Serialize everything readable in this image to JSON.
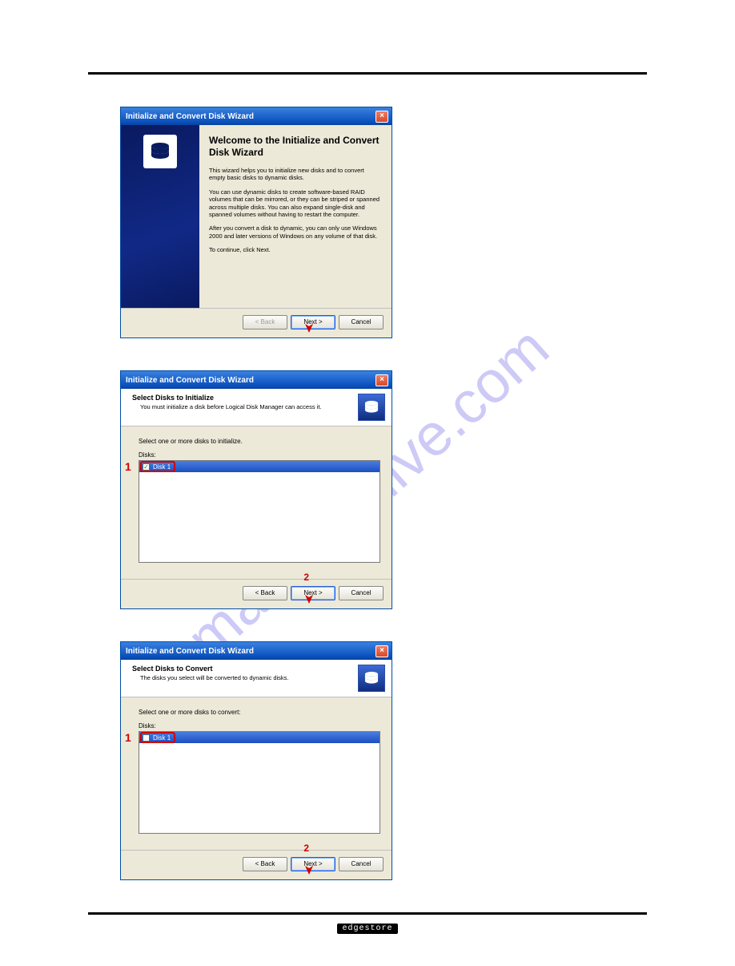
{
  "watermark": "manualshive.com",
  "footer_brand": "edgestore",
  "annotations": {
    "step1": "1",
    "step2": "2"
  },
  "dialog1": {
    "title": "Initialize and Convert Disk Wizard",
    "heading": "Welcome to the Initialize and Convert Disk Wizard",
    "p1": "This wizard helps you to initialize new disks and to convert empty basic disks to dynamic disks.",
    "p2": "You can use dynamic disks to create software-based RAID volumes that can be mirrored, or they can be striped or spanned across multiple disks. You can also expand single-disk and spanned volumes without having to restart the computer.",
    "p3": "After you convert a disk to dynamic, you can only use Windows 2000 and later versions of Windows on any volume of that disk.",
    "p4": "To continue, click Next.",
    "back": "< Back",
    "next": "Next >",
    "cancel": "Cancel"
  },
  "dialog2": {
    "title": "Initialize and Convert Disk Wizard",
    "step_title": "Select Disks to Initialize",
    "step_sub": "You must initialize a disk before Logical Disk Manager can access it.",
    "instruction": "Select one or more disks to initialize.",
    "list_label": "Disks:",
    "disk_item": "Disk 1",
    "disk_checked": true,
    "back": "< Back",
    "next": "Next >",
    "cancel": "Cancel"
  },
  "dialog3": {
    "title": "Initialize and Convert Disk Wizard",
    "step_title": "Select Disks to Convert",
    "step_sub": "The disks you select will be converted to dynamic disks.",
    "instruction": "Select one or more disks to convert:",
    "list_label": "Disks:",
    "disk_item": "Disk 1",
    "disk_checked": false,
    "back": "< Back",
    "next": "Next >",
    "cancel": "Cancel"
  }
}
